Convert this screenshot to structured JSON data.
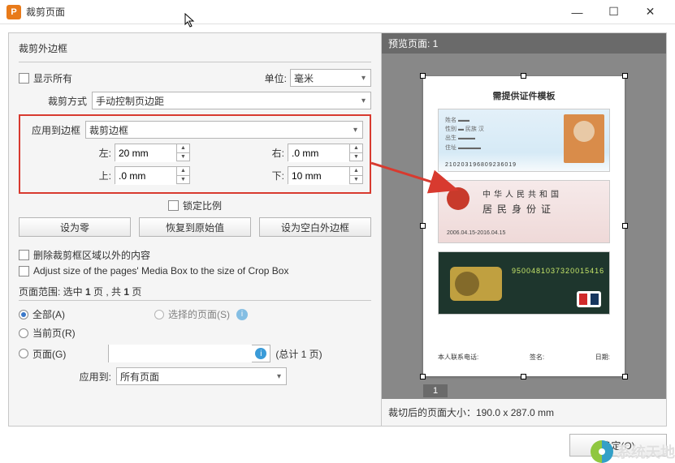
{
  "window": {
    "title": "裁剪页面",
    "min": "—",
    "max": "☐",
    "close": "✕"
  },
  "crop_margin": {
    "group_title": "裁剪外边框",
    "show_all": "显示所有",
    "unit_label": "单位:",
    "unit_value": "毫米",
    "mode_label": "裁剪方式",
    "mode_value": "手动控制页边距",
    "apply_to_label": "应用到边框",
    "apply_to_value": "裁剪边框",
    "left_label": "左:",
    "left_value": "20 mm",
    "right_label": "右:",
    "right_value": ".0 mm",
    "top_label": "上:",
    "top_value": ".0 mm",
    "bottom_label": "下:",
    "bottom_value": "10 mm",
    "lock_ratio": "锁定比例",
    "btn_zero": "设为零",
    "btn_restore": "恢复到原始值",
    "btn_blank": "设为空白外边框",
    "remove_outside": "删除裁剪框区域以外的内容",
    "adjust_mediabox": "Adjust size of the pages' Media Box to the size of Crop Box"
  },
  "page_range": {
    "title_prefix": "页面范围: 选中 ",
    "title_bold1": "1",
    "title_mid": " 页 , 共 ",
    "title_bold2": "1",
    "title_suffix": " 页",
    "all": "全部(A)",
    "selected": "选择的页面(S)",
    "current": "当前页(R)",
    "pages": "页面(G)",
    "pages_total": "(总计 1 页)",
    "apply_to_label": "应用到:",
    "apply_to_value": "所有页面"
  },
  "preview": {
    "header": "预览页面: 1",
    "doc_title": "需提供证件模板",
    "card1_barcode": "210203196809236019",
    "card2_title": "中华人民共和国",
    "card2_sub": "居民身份证",
    "card2_date": "2006.04.15-2016.04.15",
    "card3_num": "9500481037320015416",
    "footer_contact": "本人联系电话:",
    "footer_sign": "签名:",
    "footer_date": "日期:",
    "page_num": "1",
    "cropped_size": "裁切后的页面大小：190.0 x 287.0 mm"
  },
  "buttons": {
    "ok": "确定(O)"
  },
  "watermark": "系统天地"
}
